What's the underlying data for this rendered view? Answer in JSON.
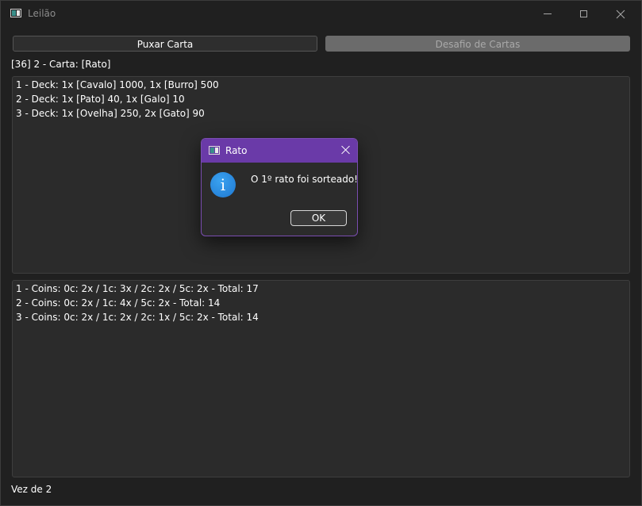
{
  "window": {
    "title": "Leilão"
  },
  "toolbar": {
    "draw_card_label": "Puxar Carta",
    "card_challenge_label": "Desafio de Cartas"
  },
  "status": "[36] 2 - Carta: [Rato]",
  "decks": [
    "1 - Deck: 1x [Cavalo] 1000, 1x [Burro] 500",
    "2 - Deck: 1x [Pato] 40, 1x [Galo] 10",
    "3 - Deck: 1x [Ovelha] 250, 2x [Gato] 90"
  ],
  "coins": [
    "1 - Coins: 0c: 2x / 1c: 3x / 2c: 2x / 5c: 2x - Total: 17",
    "2 - Coins: 0c: 2x / 1c: 4x / 5c: 2x - Total: 14",
    "3 - Coins: 0c: 2x / 1c: 2x / 2c: 1x / 5c: 2x - Total: 14"
  ],
  "footer": "Vez de 2",
  "dialog": {
    "title": "Rato",
    "message": "O 1º rato foi sorteado!",
    "ok_label": "OK",
    "icon": "info-icon"
  },
  "colors": {
    "dialog_title_bar": "#6a3aa8",
    "info_icon": "#1f78d1"
  }
}
